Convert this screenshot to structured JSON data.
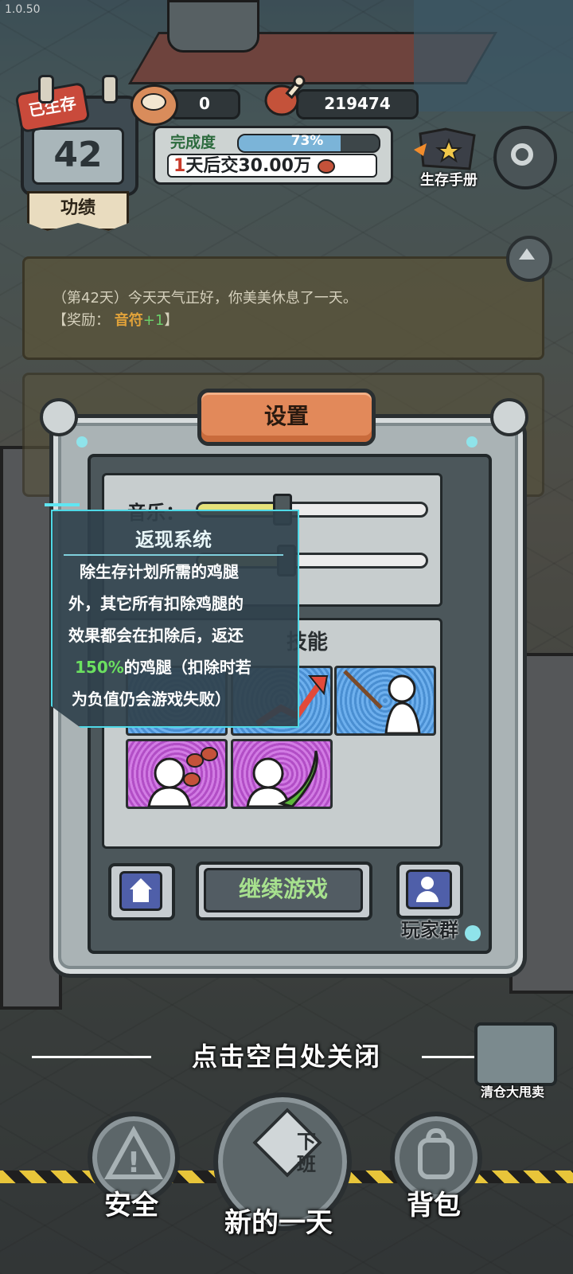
{
  "version": "1.0.50",
  "hud": {
    "survived_badge": "已生存",
    "day_count": "42",
    "merit_label": "功绩",
    "cans": "0",
    "drumsticks": "219474",
    "completion_label": "完成度",
    "completion_pct": "73%",
    "completion_value": 0.73,
    "due_days": "1",
    "due_text": "天后交",
    "due_amount": "30.00万",
    "manual_label": "生存手册"
  },
  "log": {
    "line1": "（第42天）今天天气正好，你美美休息了一天。",
    "reward_prefix": "【奖励：",
    "reward_item": "音符",
    "reward_amount": "+1",
    "reward_suffix": "】"
  },
  "settings": {
    "title": "设置",
    "music_label": "音乐：",
    "music_level": 0.38,
    "sfx_level": 0.4,
    "skills_title": "技能",
    "continue_label": "继续游戏",
    "group_label": "玩家群"
  },
  "tooltip": {
    "title": "返现系统",
    "line1": "除生存计划所需的鸡腿",
    "line2": "外，其它所有扣除鸡腿的",
    "line3": "效果都会在扣除后，返还",
    "line4_green": "150%",
    "line4_rest": "的鸡腿（扣除时若",
    "line5": "为负值仍会游戏失败）"
  },
  "close_hint": "点击空白处关闭",
  "clearance_label": "清仓大甩卖",
  "nav": {
    "safety": "安全",
    "new_day": "新的一天",
    "off_work": "下班",
    "bag": "背包"
  },
  "colors": {
    "accent_orange": "#e2895a",
    "continue_green": "#a7e18e",
    "cashback_green": "#6be060",
    "due_red": "#c83a2a"
  }
}
